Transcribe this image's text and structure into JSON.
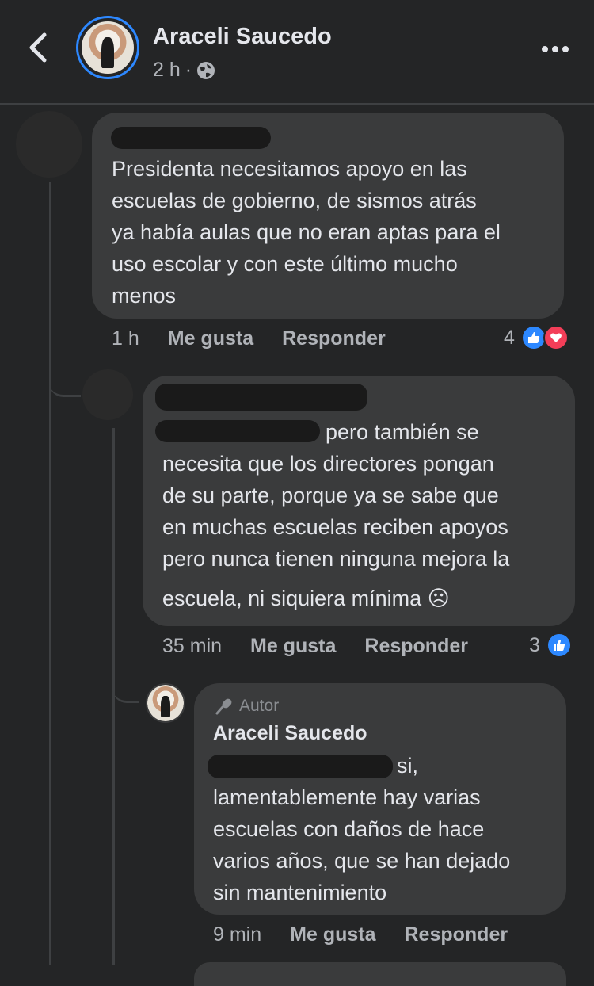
{
  "header": {
    "name": "Araceli Saucedo",
    "time": "2 h",
    "separator": "·"
  },
  "comments": [
    {
      "text_lines": [
        "Presidenta necesitamos apoyo en las",
        "escuelas de gobierno, de sismos atrás",
        "ya había aulas que no eran aptas para el",
        "uso escolar y con este último mucho",
        "menos"
      ],
      "time": "1 h",
      "like_label": "Me gusta",
      "reply_label": "Responder",
      "reaction_count": "4"
    },
    {
      "first_line_tail": "pero también se",
      "text_lines": [
        "necesita que los directores pongan",
        "de su parte, porque ya se sabe que",
        "en muchas escuelas reciben apoyos",
        "pero nunca tienen ninguna mejora la",
        "escuela, ni siquiera mínima ☹"
      ],
      "time": "35 min",
      "like_label": "Me gusta",
      "reply_label": "Responder",
      "reaction_count": "3"
    },
    {
      "badge": "Autor",
      "author": "Araceli Saucedo",
      "first_line_tail": "si,",
      "text_lines": [
        "lamentablemente hay varias",
        "escuelas con daños de hace",
        "varios años, que se han dejado",
        "sin mantenimiento"
      ],
      "time": "9 min",
      "like_label": "Me gusta",
      "reply_label": "Responder"
    }
  ]
}
